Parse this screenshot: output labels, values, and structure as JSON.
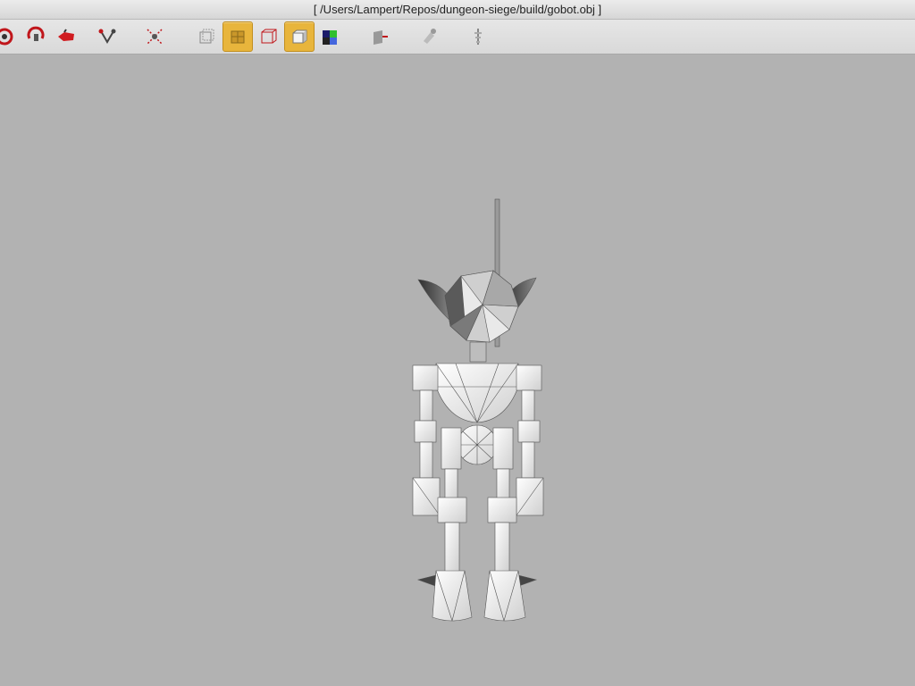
{
  "window": {
    "title": "[ /Users/Lampert/Repos/dungeon-siege/build/gobot.obj ]"
  },
  "toolbar": {
    "buttons": [
      {
        "icon": "rotate-view-icon",
        "active": false
      },
      {
        "icon": "orbit-icon",
        "active": false
      },
      {
        "icon": "move-object-icon",
        "active": false
      },
      {
        "icon": "measure-icon",
        "active": false
      },
      {
        "icon": "center-view-icon",
        "active": false
      },
      {
        "icon": "bounding-box-icon",
        "active": false
      },
      {
        "icon": "wireframe-overlay-icon",
        "active": true
      },
      {
        "icon": "wireframe-only-icon",
        "active": false
      },
      {
        "icon": "solid-shading-icon",
        "active": true
      },
      {
        "icon": "texture-checker-icon",
        "active": false
      },
      {
        "icon": "normals-icon",
        "active": false
      },
      {
        "icon": "light-icon",
        "active": false
      },
      {
        "icon": "skeleton-icon",
        "active": false
      }
    ]
  },
  "viewport": {
    "background": "#b2b2b2",
    "model": "gobot"
  },
  "colors": {
    "active_button": "#e8b53c",
    "mesh_fill": "#f4f4f4",
    "mesh_lines": "#555555",
    "mesh_dark": "#3a3a3a"
  }
}
